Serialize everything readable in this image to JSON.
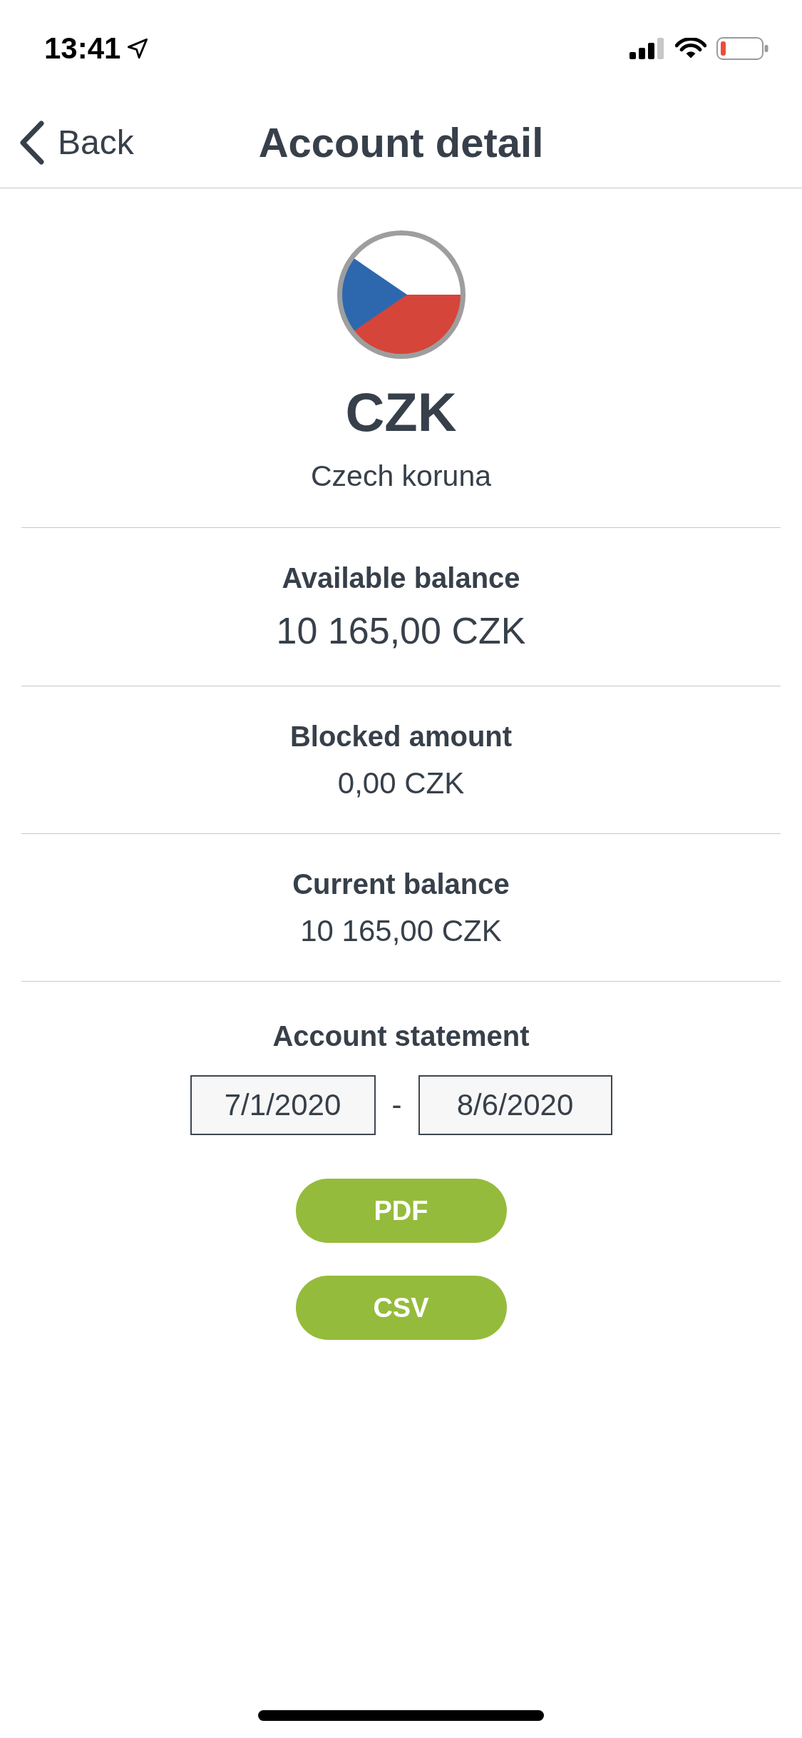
{
  "status_bar": {
    "time": "13:41"
  },
  "nav": {
    "back_label": "Back",
    "title": "Account detail"
  },
  "currency": {
    "code": "CZK",
    "name": "Czech koruna"
  },
  "balances": [
    {
      "kind": "primary",
      "label": "Available balance",
      "value": "10 165,00 CZK"
    },
    {
      "kind": "secondary",
      "label": "Blocked amount",
      "value": "0,00 CZK"
    },
    {
      "kind": "secondary",
      "label": "Current balance",
      "value": "10 165,00 CZK"
    }
  ],
  "statement": {
    "title": "Account statement",
    "date_from": "7/1/2020",
    "separator": "-",
    "date_to": "8/6/2020",
    "buttons": [
      "PDF",
      "CSV"
    ]
  }
}
